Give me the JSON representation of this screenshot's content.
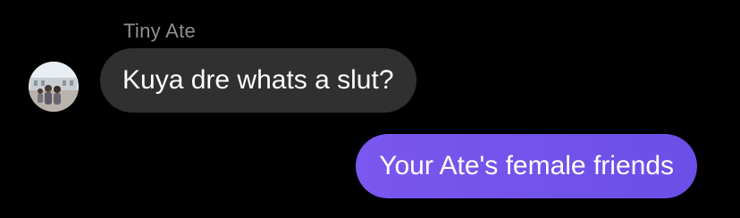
{
  "thread": {
    "incoming": {
      "sender_name": "Tiny Ate",
      "text": "Kuya dre whats a slut?",
      "bubble_color": "#303030"
    },
    "outgoing": {
      "text": "Your Ate's female friends",
      "bubble_color": "#6f52ea"
    }
  },
  "icons": {
    "avatar": "contact-photo-avatar"
  }
}
